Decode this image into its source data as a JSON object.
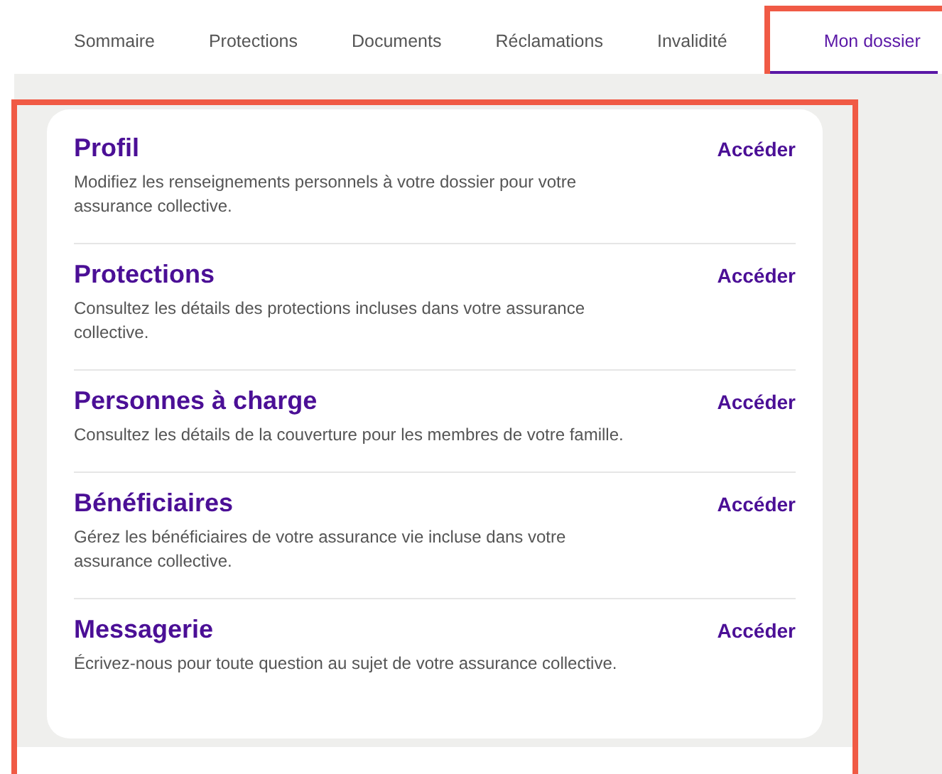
{
  "tabs": [
    {
      "label": "Sommaire",
      "selected": false,
      "highlighted": false
    },
    {
      "label": "Protections",
      "selected": false,
      "highlighted": false
    },
    {
      "label": "Documents",
      "selected": false,
      "highlighted": false
    },
    {
      "label": "Réclamations",
      "selected": false,
      "highlighted": false
    },
    {
      "label": "Invalidité",
      "selected": false,
      "highlighted": false
    },
    {
      "label": "Mon dossier",
      "selected": true,
      "highlighted": true
    }
  ],
  "panel": {
    "highlighted": true,
    "items": [
      {
        "title": "Profil",
        "description": "Modifiez les renseignements personnels à votre dossier pour votre assurance collective.",
        "link": "Accéder"
      },
      {
        "title": "Protections",
        "description": "Consultez les détails des protections incluses dans votre assurance collective.",
        "link": "Accéder"
      },
      {
        "title": "Personnes à charge",
        "description": "Consultez les détails de la couverture pour les membres de votre famille.",
        "link": "Accéder"
      },
      {
        "title": "Bénéficiaires",
        "description": "Gérez les bénéficiaires de votre assurance vie incluse dans votre assurance collective.",
        "link": "Accéder"
      },
      {
        "title": "Messagerie",
        "description": "Écrivez-nous pour toute question au sujet de votre assurance collective.",
        "link": "Accéder"
      }
    ]
  }
}
